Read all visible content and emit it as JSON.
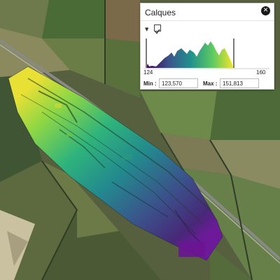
{
  "panel": {
    "title": "Calques",
    "close_icon": "close-icon",
    "expand_icon": "caret-down-icon",
    "visible_checkbox": true,
    "histogram": {
      "range_min_label": "124",
      "range_max_label": "160"
    },
    "min": {
      "label": "Min :",
      "value": "123,570"
    },
    "max": {
      "label": "Max :",
      "value": "151,813"
    }
  },
  "colors": {
    "ramp": [
      "#440154",
      "#3b528b",
      "#21908d",
      "#5dc962",
      "#fde725"
    ]
  }
}
